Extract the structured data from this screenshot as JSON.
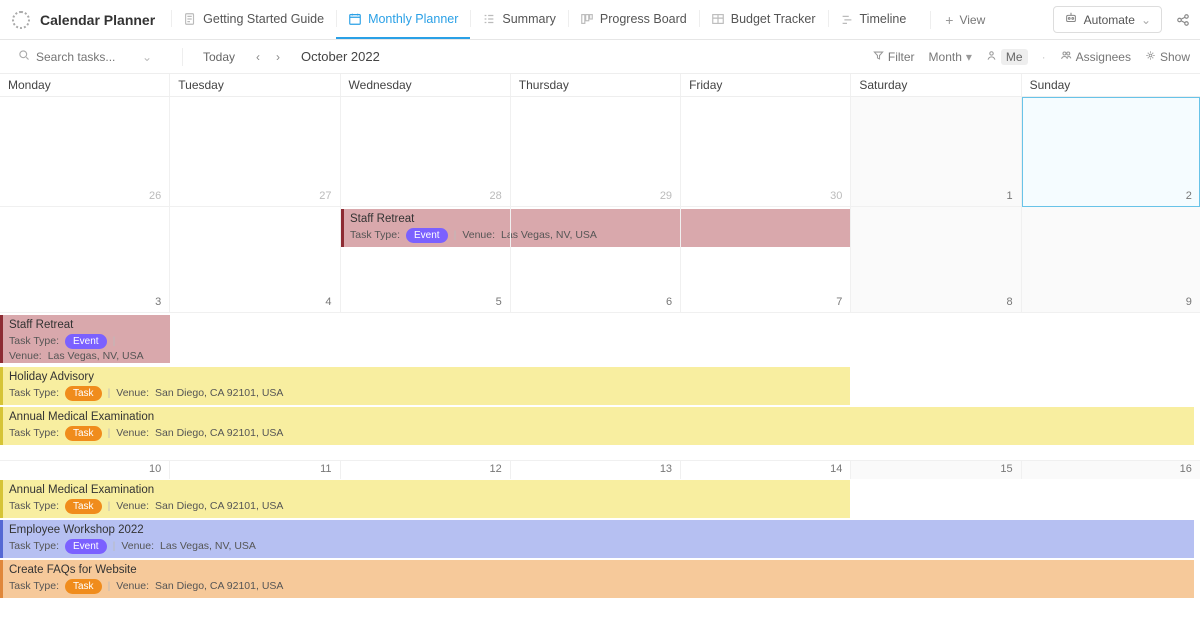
{
  "header": {
    "title": "Calendar Planner",
    "tabs": [
      {
        "label": "Getting Started Guide"
      },
      {
        "label": "Monthly Planner"
      },
      {
        "label": "Summary"
      },
      {
        "label": "Progress Board"
      },
      {
        "label": "Budget Tracker"
      },
      {
        "label": "Timeline"
      }
    ],
    "add_view": "View",
    "automate": "Automate"
  },
  "toolbar": {
    "search_placeholder": "Search tasks...",
    "today": "Today",
    "month": "October 2022",
    "filter": "Filter",
    "period": "Month",
    "me": "Me",
    "assignees": "Assignees",
    "show": "Show"
  },
  "days": [
    "Monday",
    "Tuesday",
    "Wednesday",
    "Thursday",
    "Friday",
    "Saturday",
    "Sunday"
  ],
  "weeks": {
    "w1": [
      "26",
      "27",
      "28",
      "29",
      "30",
      "1",
      "2"
    ],
    "w2": [
      "3",
      "4",
      "5",
      "6",
      "7",
      "8",
      "9"
    ],
    "w3": [
      "10",
      "11",
      "12",
      "13",
      "14",
      "15",
      "16"
    ]
  },
  "labels": {
    "task_type": "Task Type:",
    "venue": "Venue:",
    "event": "Event",
    "task": "Task"
  },
  "events": {
    "staff_retreat": {
      "title": "Staff Retreat",
      "venue": "Las Vegas, NV, USA"
    },
    "holiday_advisory": {
      "title": "Holiday Advisory",
      "venue": "San Diego, CA 92101, USA"
    },
    "annual_medical": {
      "title": "Annual Medical Examination",
      "venue": "San Diego, CA 92101, USA"
    },
    "employee_workshop": {
      "title": "Employee Workshop 2022",
      "venue": "Las Vegas, NV, USA"
    },
    "create_faqs": {
      "title": "Create FAQs for Website",
      "venue": "San Diego, CA 92101, USA"
    }
  }
}
